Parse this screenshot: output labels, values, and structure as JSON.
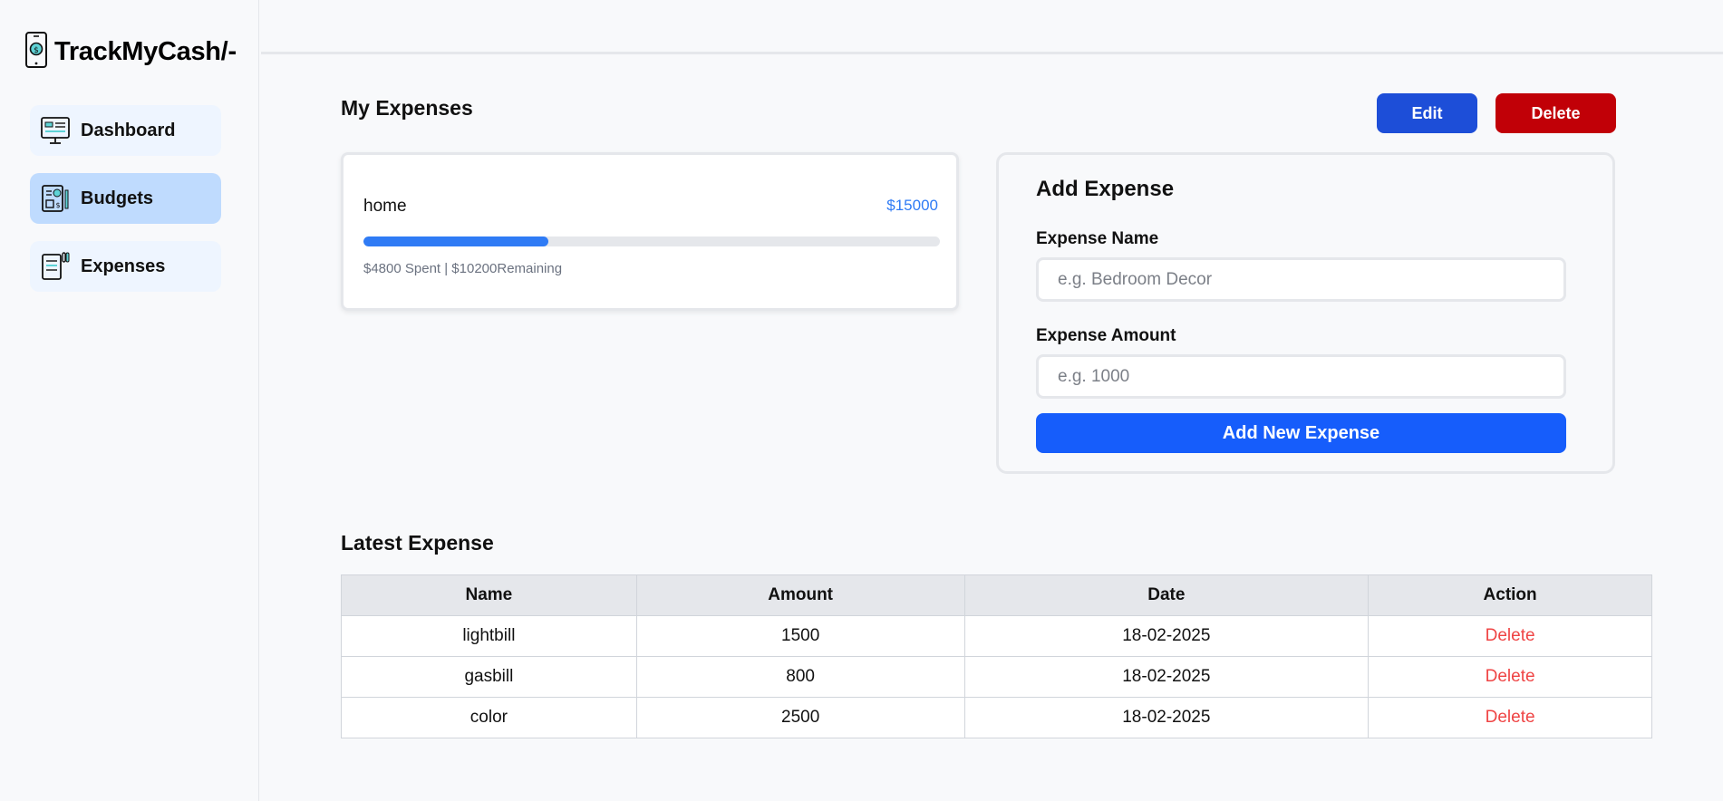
{
  "brand": {
    "title": "TrackMyCash/-",
    "icon": "phone-dollar-icon"
  },
  "sidebar": {
    "items": [
      {
        "label": "Dashboard",
        "icon": "monitor-icon"
      },
      {
        "label": "Budgets",
        "icon": "budget-sheet-icon",
        "active": true
      },
      {
        "label": "Expenses",
        "icon": "expense-clipboard-icon"
      }
    ]
  },
  "main": {
    "title": "My Expenses",
    "edit_label": "Edit",
    "delete_label": "Delete"
  },
  "budget": {
    "name": "home",
    "amount": "$15000",
    "meta": "$4800 Spent | $10200Remaining",
    "progress_fraction": 0.32,
    "accent": "#2f7bf5"
  },
  "add_expense": {
    "title": "Add Expense",
    "name_label": "Expense Name",
    "name_placeholder": "e.g. Bedroom Decor",
    "amount_label": "Expense Amount",
    "amount_placeholder": "e.g. 1000",
    "submit_label": "Add New Expense"
  },
  "latest": {
    "title": "Latest Expense",
    "columns": [
      "Name",
      "Amount",
      "Date",
      "Action"
    ],
    "rows": [
      {
        "name": "lightbill",
        "amount": "1500",
        "date": "18-02-2025",
        "action": "Delete"
      },
      {
        "name": "gasbill",
        "amount": "800",
        "date": "18-02-2025",
        "action": "Delete"
      },
      {
        "name": "color",
        "amount": "2500",
        "date": "18-02-2025",
        "action": "Delete"
      }
    ]
  },
  "colors": {
    "primary": "#165dfb",
    "edit": "#1d4ed8",
    "danger": "#c10007",
    "delete_text": "#ef4444"
  }
}
